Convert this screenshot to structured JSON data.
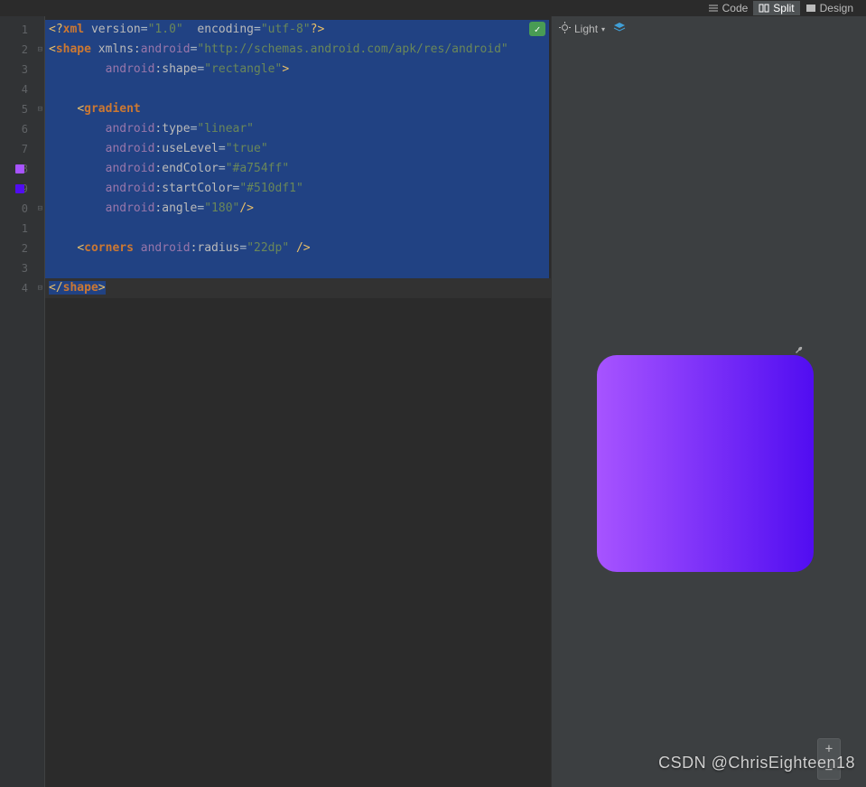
{
  "tabs": {
    "code": "Code",
    "split": "Split",
    "design": "Design",
    "active": "split"
  },
  "preview_toolbar": {
    "theme_label": "Light"
  },
  "gutter": {
    "lines": [
      "1",
      "2",
      "3",
      "4",
      "5",
      "6",
      "7",
      "8",
      "9",
      "0",
      "1",
      "2",
      "3",
      "4"
    ]
  },
  "swatches": {
    "line8": "#a754ff",
    "line9": "#510df1"
  },
  "watermark": "CSDN @ChrisEighteen18",
  "code": {
    "l1": {
      "open": "<?",
      "xml": "xml",
      "version_k": " version",
      "eq": "=",
      "version_v": "\"1.0\"",
      "sp": "  ",
      "encoding_k": "encoding",
      "encoding_v": "\"utf-8\"",
      "close": "?>"
    },
    "l2": {
      "open": "<",
      "tag": "shape",
      "sp": " ",
      "xmlns_k": "xmlns:",
      "xmlns_n": "android",
      "eq": "=",
      "xmlns_v": "\"http://schemas.android.com/apk/res/android\""
    },
    "l3": {
      "indent": "        ",
      "ns": "android",
      "colon": ":",
      "attr": "shape",
      "eq": "=",
      "val": "\"rectangle\"",
      "close": ">"
    },
    "l4": {
      "blank": ""
    },
    "l5": {
      "indent": "    ",
      "open": "<",
      "tag": "gradient"
    },
    "l6": {
      "indent": "        ",
      "ns": "android",
      "colon": ":",
      "attr": "type",
      "eq": "=",
      "val": "\"linear\""
    },
    "l7": {
      "indent": "        ",
      "ns": "android",
      "colon": ":",
      "attr": "useLevel",
      "eq": "=",
      "val": "\"true\""
    },
    "l8": {
      "indent": "        ",
      "ns": "android",
      "colon": ":",
      "attr": "endColor",
      "eq": "=",
      "val": "\"#a754ff\""
    },
    "l9": {
      "indent": "        ",
      "ns": "android",
      "colon": ":",
      "attr": "startColor",
      "eq": "=",
      "val": "\"#510df1\""
    },
    "l10": {
      "indent": "        ",
      "ns": "android",
      "colon": ":",
      "attr": "angle",
      "eq": "=",
      "val": "\"180\"",
      "close": "/>"
    },
    "l11": {
      "blank": ""
    },
    "l12": {
      "indent": "    ",
      "open": "<",
      "tag": "corners",
      "sp": " ",
      "ns": "android",
      "colon": ":",
      "attr": "radius",
      "eq": "=",
      "val": "\"22dp\"",
      "close": " />"
    },
    "l13": {
      "blank": ""
    },
    "l14": {
      "open": "</",
      "tag": "shape",
      "close": ">"
    }
  },
  "shape": {
    "start_color": "#510df1",
    "end_color": "#a754ff",
    "radius": "22px",
    "angle": "180"
  }
}
